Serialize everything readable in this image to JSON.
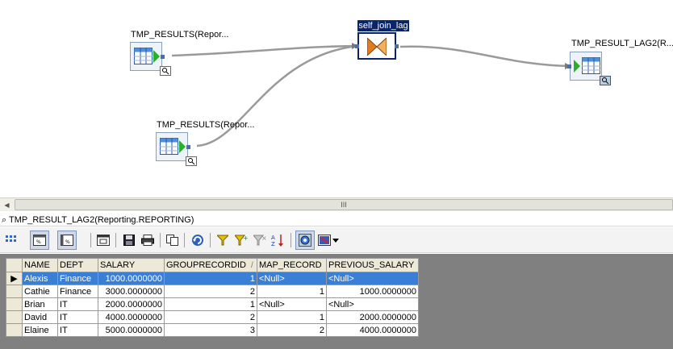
{
  "canvas": {
    "source1_label": "TMP_RESULTS(Repor...",
    "source2_label": "TMP_RESULTS(Repor...",
    "join_label": "self_join_lag",
    "target_label": "TMP_RESULT_LAG2(R..."
  },
  "scrollbar": {
    "grip": "III"
  },
  "viewer": {
    "title_icon": "⌕",
    "title": "TMP_RESULT_LAG2(Reporting.REPORTING)"
  },
  "toolbar": {
    "icons": [
      "grid-handle-icon",
      "view-a-icon",
      "view-b-icon",
      "export-icon",
      "save-icon",
      "print-icon",
      "copy-icon",
      "refresh-icon",
      "filter-icon",
      "filter-add-icon",
      "filter-clear-icon",
      "sort-icon",
      "data-viewer-icon",
      "chart-icon",
      "dropdown-arrow-icon"
    ]
  },
  "grid": {
    "columns": [
      "NAME",
      "DEPT",
      "SALARY",
      "GROUPRECORDID",
      "MAP_RECORD",
      "PREVIOUS_SALARY"
    ],
    "sort_marker": "/",
    "row_marker": "▶",
    "rows": [
      {
        "name": "Alexis",
        "dept": "Finance",
        "salary": "1000.0000000",
        "grp": "1",
        "map": "<Null>",
        "prev": "<Null>"
      },
      {
        "name": "Cathie",
        "dept": "Finance",
        "salary": "3000.0000000",
        "grp": "2",
        "map": "1",
        "prev": "1000.0000000"
      },
      {
        "name": "Brian",
        "dept": "IT",
        "salary": "2000.0000000",
        "grp": "1",
        "map": "<Null>",
        "prev": "<Null>"
      },
      {
        "name": "David",
        "dept": "IT",
        "salary": "4000.0000000",
        "grp": "2",
        "map": "1",
        "prev": "2000.0000000"
      },
      {
        "name": "Elaine",
        "dept": "IT",
        "salary": "5000.0000000",
        "grp": "3",
        "map": "2",
        "prev": "4000.0000000"
      }
    ],
    "selected_row": 0
  }
}
